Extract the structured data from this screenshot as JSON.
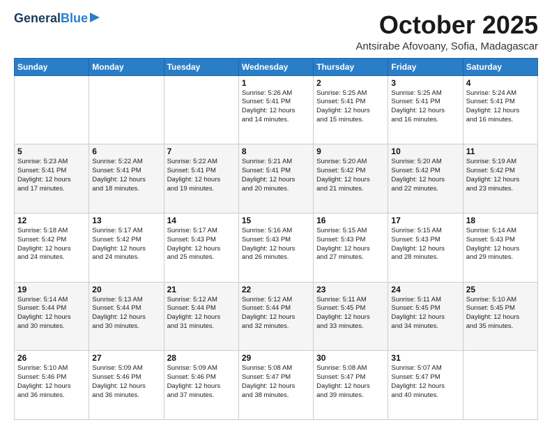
{
  "header": {
    "logo_general": "General",
    "logo_blue": "Blue",
    "month_title": "October 2025",
    "location": "Antsirabe Afovoany, Sofia, Madagascar"
  },
  "days_of_week": [
    "Sunday",
    "Monday",
    "Tuesday",
    "Wednesday",
    "Thursday",
    "Friday",
    "Saturday"
  ],
  "weeks": [
    [
      {
        "day": "",
        "info": ""
      },
      {
        "day": "",
        "info": ""
      },
      {
        "day": "",
        "info": ""
      },
      {
        "day": "1",
        "info": "Sunrise: 5:26 AM\nSunset: 5:41 PM\nDaylight: 12 hours\nand 14 minutes."
      },
      {
        "day": "2",
        "info": "Sunrise: 5:25 AM\nSunset: 5:41 PM\nDaylight: 12 hours\nand 15 minutes."
      },
      {
        "day": "3",
        "info": "Sunrise: 5:25 AM\nSunset: 5:41 PM\nDaylight: 12 hours\nand 16 minutes."
      },
      {
        "day": "4",
        "info": "Sunrise: 5:24 AM\nSunset: 5:41 PM\nDaylight: 12 hours\nand 16 minutes."
      }
    ],
    [
      {
        "day": "5",
        "info": "Sunrise: 5:23 AM\nSunset: 5:41 PM\nDaylight: 12 hours\nand 17 minutes."
      },
      {
        "day": "6",
        "info": "Sunrise: 5:22 AM\nSunset: 5:41 PM\nDaylight: 12 hours\nand 18 minutes."
      },
      {
        "day": "7",
        "info": "Sunrise: 5:22 AM\nSunset: 5:41 PM\nDaylight: 12 hours\nand 19 minutes."
      },
      {
        "day": "8",
        "info": "Sunrise: 5:21 AM\nSunset: 5:41 PM\nDaylight: 12 hours\nand 20 minutes."
      },
      {
        "day": "9",
        "info": "Sunrise: 5:20 AM\nSunset: 5:42 PM\nDaylight: 12 hours\nand 21 minutes."
      },
      {
        "day": "10",
        "info": "Sunrise: 5:20 AM\nSunset: 5:42 PM\nDaylight: 12 hours\nand 22 minutes."
      },
      {
        "day": "11",
        "info": "Sunrise: 5:19 AM\nSunset: 5:42 PM\nDaylight: 12 hours\nand 23 minutes."
      }
    ],
    [
      {
        "day": "12",
        "info": "Sunrise: 5:18 AM\nSunset: 5:42 PM\nDaylight: 12 hours\nand 24 minutes."
      },
      {
        "day": "13",
        "info": "Sunrise: 5:17 AM\nSunset: 5:42 PM\nDaylight: 12 hours\nand 24 minutes."
      },
      {
        "day": "14",
        "info": "Sunrise: 5:17 AM\nSunset: 5:43 PM\nDaylight: 12 hours\nand 25 minutes."
      },
      {
        "day": "15",
        "info": "Sunrise: 5:16 AM\nSunset: 5:43 PM\nDaylight: 12 hours\nand 26 minutes."
      },
      {
        "day": "16",
        "info": "Sunrise: 5:15 AM\nSunset: 5:43 PM\nDaylight: 12 hours\nand 27 minutes."
      },
      {
        "day": "17",
        "info": "Sunrise: 5:15 AM\nSunset: 5:43 PM\nDaylight: 12 hours\nand 28 minutes."
      },
      {
        "day": "18",
        "info": "Sunrise: 5:14 AM\nSunset: 5:43 PM\nDaylight: 12 hours\nand 29 minutes."
      }
    ],
    [
      {
        "day": "19",
        "info": "Sunrise: 5:14 AM\nSunset: 5:44 PM\nDaylight: 12 hours\nand 30 minutes."
      },
      {
        "day": "20",
        "info": "Sunrise: 5:13 AM\nSunset: 5:44 PM\nDaylight: 12 hours\nand 30 minutes."
      },
      {
        "day": "21",
        "info": "Sunrise: 5:12 AM\nSunset: 5:44 PM\nDaylight: 12 hours\nand 31 minutes."
      },
      {
        "day": "22",
        "info": "Sunrise: 5:12 AM\nSunset: 5:44 PM\nDaylight: 12 hours\nand 32 minutes."
      },
      {
        "day": "23",
        "info": "Sunrise: 5:11 AM\nSunset: 5:45 PM\nDaylight: 12 hours\nand 33 minutes."
      },
      {
        "day": "24",
        "info": "Sunrise: 5:11 AM\nSunset: 5:45 PM\nDaylight: 12 hours\nand 34 minutes."
      },
      {
        "day": "25",
        "info": "Sunrise: 5:10 AM\nSunset: 5:45 PM\nDaylight: 12 hours\nand 35 minutes."
      }
    ],
    [
      {
        "day": "26",
        "info": "Sunrise: 5:10 AM\nSunset: 5:46 PM\nDaylight: 12 hours\nand 36 minutes."
      },
      {
        "day": "27",
        "info": "Sunrise: 5:09 AM\nSunset: 5:46 PM\nDaylight: 12 hours\nand 36 minutes."
      },
      {
        "day": "28",
        "info": "Sunrise: 5:09 AM\nSunset: 5:46 PM\nDaylight: 12 hours\nand 37 minutes."
      },
      {
        "day": "29",
        "info": "Sunrise: 5:08 AM\nSunset: 5:47 PM\nDaylight: 12 hours\nand 38 minutes."
      },
      {
        "day": "30",
        "info": "Sunrise: 5:08 AM\nSunset: 5:47 PM\nDaylight: 12 hours\nand 39 minutes."
      },
      {
        "day": "31",
        "info": "Sunrise: 5:07 AM\nSunset: 5:47 PM\nDaylight: 12 hours\nand 40 minutes."
      },
      {
        "day": "",
        "info": ""
      }
    ]
  ]
}
